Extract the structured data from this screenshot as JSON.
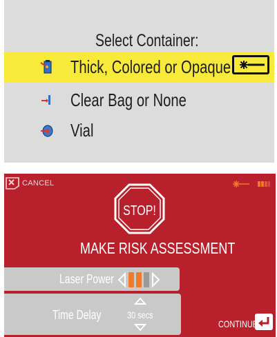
{
  "top": {
    "title": "Select Container:",
    "items": [
      {
        "label": "Thick, Colored or Opaque",
        "selected": true,
        "icon": "thick-container-icon"
      },
      {
        "label": "Clear Bag or None",
        "selected": false,
        "icon": "clear-bag-icon"
      },
      {
        "label": "Vial",
        "selected": false,
        "icon": "vial-icon"
      }
    ],
    "colors": {
      "highlight": "#f7ea3a",
      "panel": "#dcdcdc"
    }
  },
  "bottom": {
    "cancel_label": "CANCEL",
    "stop_text": "STOP!",
    "heading": "MAKE RISK ASSESSMENT",
    "laser_power": {
      "label": "Laser Power",
      "level": 2,
      "max": 3
    },
    "time_delay": {
      "label": "Time Delay",
      "value": "30 secs"
    },
    "continue_label": "CONTINUE",
    "colors": {
      "background": "#b8202c",
      "accent": "#f07a2a"
    }
  }
}
